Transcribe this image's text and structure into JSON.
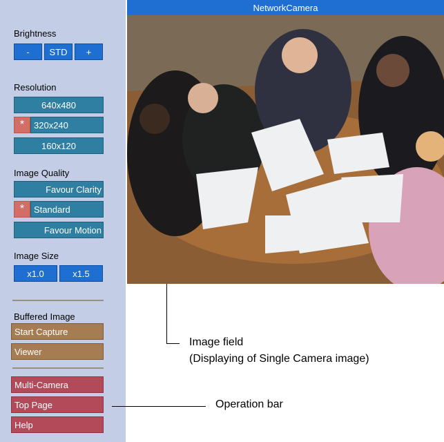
{
  "titlebar": {
    "title": "NetworkCamera"
  },
  "brightness": {
    "label": "Brightness",
    "minus": "-",
    "std": "STD",
    "plus": "+"
  },
  "resolution": {
    "label": "Resolution",
    "options": [
      "640x480",
      "320x240",
      "160x120"
    ],
    "selected_marker": "*"
  },
  "quality": {
    "label": "Image Quality",
    "options": [
      "Favour Clarity",
      "Standard",
      "Favour Motion"
    ],
    "selected_marker": "*"
  },
  "size": {
    "label": "Image Size",
    "options": [
      "x1.0",
      "x1.5"
    ]
  },
  "buffered": {
    "label": "Buffered Image",
    "start": "Start Capture",
    "viewer": "Viewer"
  },
  "nav": {
    "multi": "Multi-Camera",
    "top": "Top Page",
    "help": "Help"
  },
  "annotations": {
    "image_field_line1": "Image field",
    "image_field_line2": "(Displaying of Single Camera image)",
    "operation_bar": "Operation bar"
  }
}
